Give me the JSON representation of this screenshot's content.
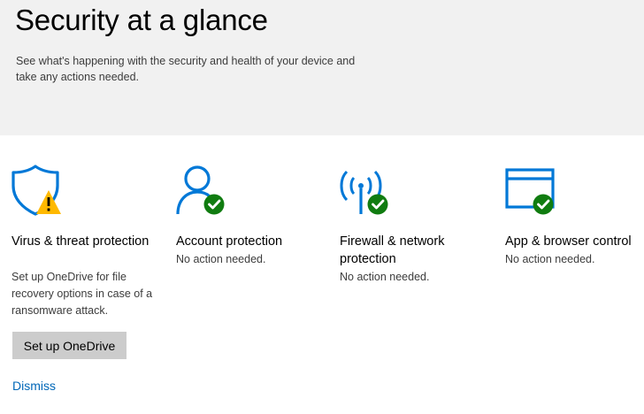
{
  "header": {
    "title": "Security at a glance",
    "subtitle": "See what's happening with the security and health of your device and take any actions needed."
  },
  "tiles": [
    {
      "icon": "virus-shield-warning-icon",
      "title": "Virus & threat protection",
      "status": "Set up OneDrive for file recovery options in case of a ransomware attack.",
      "badge": "warning",
      "action": "Set up OneDrive",
      "dismiss": "Dismiss"
    },
    {
      "icon": "account-person-check-icon",
      "title": "Account protection",
      "status": "No action needed.",
      "badge": "ok"
    },
    {
      "icon": "firewall-antenna-check-icon",
      "title": "Firewall & network protection",
      "status": "No action needed.",
      "badge": "ok"
    },
    {
      "icon": "app-browser-window-check-icon",
      "title": "App & browser control",
      "status": "No action needed.",
      "badge": "ok"
    }
  ],
  "colors": {
    "accent": "#0078d7",
    "ok": "#107c10",
    "warning": "#ffb900",
    "link": "#0067b8",
    "header_bg": "#f1f1f1",
    "button_bg": "#cccccc"
  }
}
